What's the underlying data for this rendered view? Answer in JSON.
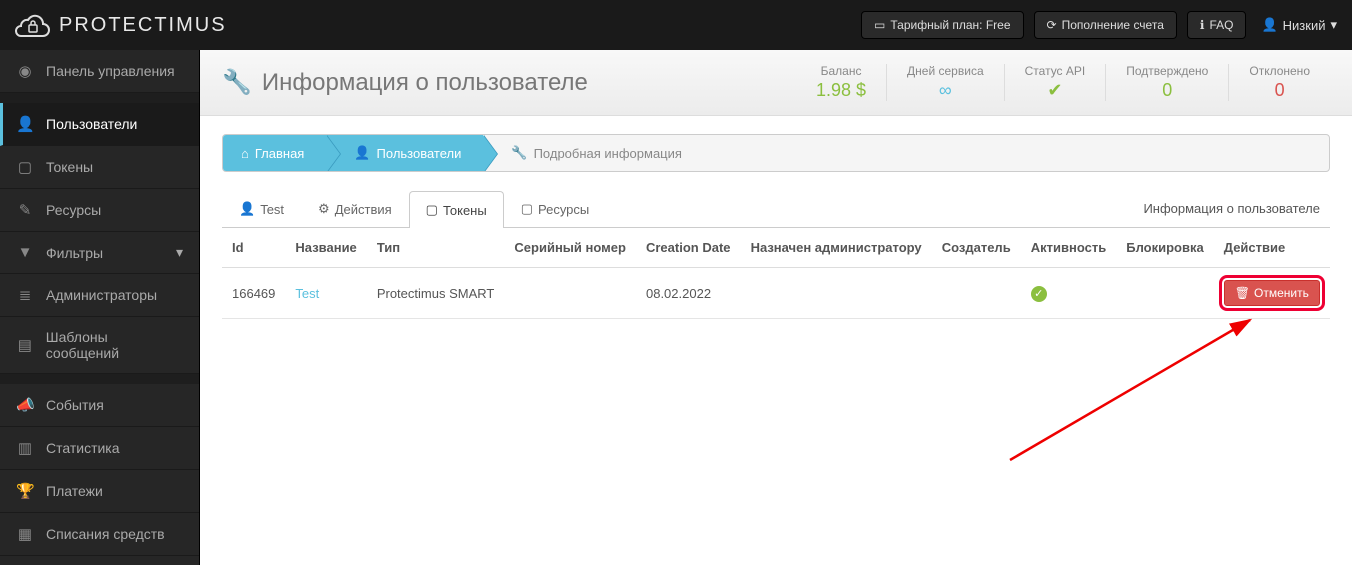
{
  "brand": "PROTECTIMUS",
  "topbar": {
    "plan": "Тарифный план: Free",
    "topup": "Пополнение счета",
    "faq": "FAQ",
    "user": "Низкий"
  },
  "sidebar": {
    "items": [
      {
        "label": "Панель управления",
        "icon": "dashboard"
      },
      {
        "label": "Пользователи",
        "icon": "user"
      },
      {
        "label": "Токены",
        "icon": "phone"
      },
      {
        "label": "Ресурсы",
        "icon": "edit"
      },
      {
        "label": "Фильтры",
        "icon": "filter"
      },
      {
        "label": "Администраторы",
        "icon": "bars"
      },
      {
        "label": "Шаблоны сообщений",
        "icon": "file"
      },
      {
        "label": "События",
        "icon": "bullhorn"
      },
      {
        "label": "Статистика",
        "icon": "chart"
      },
      {
        "label": "Платежи",
        "icon": "trophy"
      },
      {
        "label": "Списания средств",
        "icon": "receipt"
      }
    ]
  },
  "page": {
    "title": "Информация о пользователе",
    "stats": {
      "balance_label": "Баланс",
      "balance_value": "1.98 $",
      "days_label": "Дней сервиса",
      "days_value": "∞",
      "api_label": "Статус API",
      "approved_label": "Подтверждено",
      "approved_value": "0",
      "rejected_label": "Отклонено",
      "rejected_value": "0"
    }
  },
  "breadcrumb": {
    "home": "Главная",
    "users": "Пользователи",
    "detail": "Подробная информация"
  },
  "tabs": {
    "test": "Test",
    "actions": "Действия",
    "tokens": "Токены",
    "resources": "Ресурсы",
    "info": "Информация о пользователе"
  },
  "table": {
    "headers": {
      "id": "Id",
      "name": "Название",
      "type": "Тип",
      "serial": "Серийный номер",
      "creation": "Creation Date",
      "assigned": "Назначен администратору",
      "creator": "Создатель",
      "activity": "Активность",
      "block": "Блокировка",
      "action": "Действие"
    },
    "rows": [
      {
        "id": "166469",
        "name": "Test",
        "type": "Protectimus SMART",
        "serial": "",
        "creation": "08.02.2022",
        "assigned": "",
        "creator": "",
        "cancel": "Отменить"
      }
    ]
  }
}
